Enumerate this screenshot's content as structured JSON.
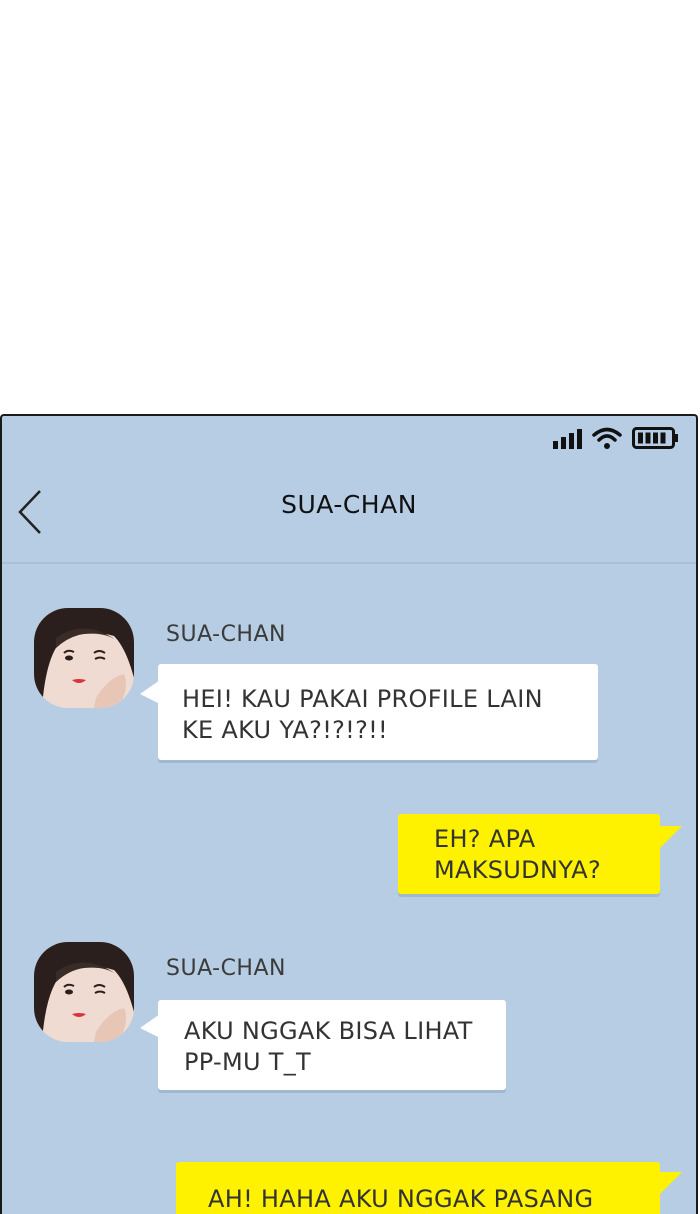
{
  "header": {
    "title": "SUA-CHAN"
  },
  "status": {
    "signal_icon": "signal-icon",
    "wifi_icon": "wifi-icon",
    "battery_icon": "battery-icon"
  },
  "colors": {
    "background": "#b6cde3",
    "incoming_bubble": "#ffffff",
    "outgoing_bubble": "#fef200"
  },
  "messages": [
    {
      "sender": "SUA-CHAN",
      "lines": [
        "HEI! KAU PAKAI PROFILE LAIN",
        "KE AKU YA?!?!?!!"
      ]
    },
    {
      "sender": "me",
      "lines": [
        "EH? APA",
        "MAKSUDNYA?"
      ]
    },
    {
      "sender": "SUA-CHAN",
      "lines": [
        "AKU NGGAK BISA LIHAT",
        "PP-MU T_T"
      ]
    },
    {
      "sender": "me",
      "lines": [
        "AH! HAHA AKU NGGAK PASANG"
      ]
    }
  ]
}
